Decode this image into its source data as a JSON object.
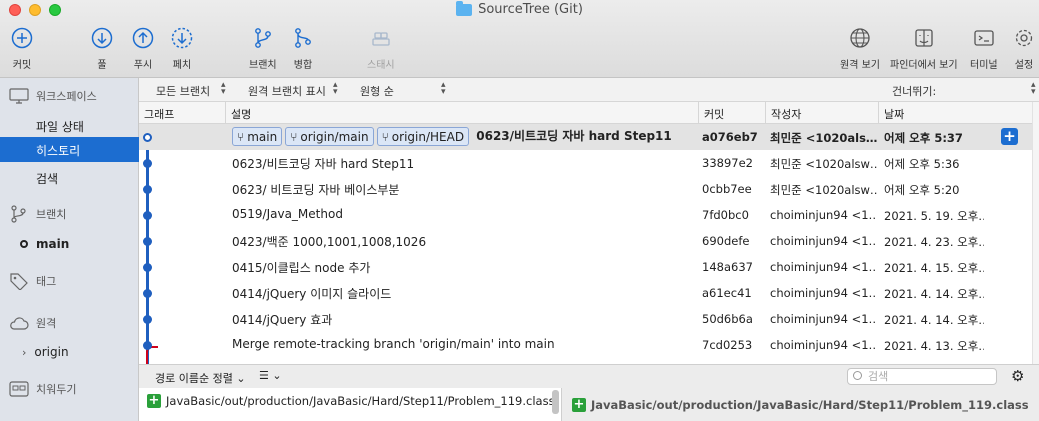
{
  "window": {
    "title": "SourceTree (Git)"
  },
  "toolbar": {
    "commit": "커밋",
    "pull": "풀",
    "push": "푸시",
    "fetch": "페치",
    "branch": "브랜치",
    "merge": "병합",
    "stash": "스태시",
    "remote_view": "원격 보기",
    "finder_view": "파인더에서 보기",
    "terminal": "터미널",
    "settings": "설정"
  },
  "filters": {
    "all_branches": "모든 브랜치",
    "show_remote": "원격 브랜치 표시",
    "order": "원형 순",
    "skip": "건너뛰기:"
  },
  "sidebar": {
    "workspace": "워크스페이스",
    "file_status": "파일 상태",
    "history": "히스토리",
    "search": "검색",
    "branches": "브랜치",
    "branch_main": "main",
    "tags": "태그",
    "remotes": "원격",
    "remote_origin": "origin",
    "stashes": "치워두기"
  },
  "columns": {
    "graph": "그래프",
    "description": "설명",
    "commit": "커밋",
    "author": "작성자",
    "date": "날짜"
  },
  "commits": [
    {
      "tags": [
        "main",
        "origin/main",
        "origin/HEAD"
      ],
      "message": "0623/비트코딩 자바 hard Step11",
      "hash": "a076eb7",
      "author": "최민준 <1020als…",
      "date": "어제 오후 5:37"
    },
    {
      "message": "0623/비트코딩 자바 hard Step11",
      "hash": "33897e2",
      "author": "최민준 <1020alsw…",
      "date": "어제 오후 5:36"
    },
    {
      "message": "0623/ 비트코딩 자바 베이스부분",
      "hash": "0cbb7ee",
      "author": "최민준 <1020alsw…",
      "date": "어제 오후 5:20"
    },
    {
      "message": "0519/Java_Method",
      "hash": "7fd0bc0",
      "author": "choiminjun94 <1…",
      "date": "2021. 5. 19. 오후…"
    },
    {
      "message": "0423/백준 1000,1001,1008,1026",
      "hash": "690defe",
      "author": "choiminjun94 <1…",
      "date": "2021. 4. 23. 오후…"
    },
    {
      "message": "0415/이클립스 node 추가",
      "hash": "148a637",
      "author": "choiminjun94 <1…",
      "date": "2021. 4. 15. 오후…"
    },
    {
      "message": "0414/jQuery 이미지 슬라이드",
      "hash": "a61ec41",
      "author": "choiminjun94 <1…",
      "date": "2021. 4. 14. 오후…"
    },
    {
      "message": "0414/jQuery 효과",
      "hash": "50d6b6a",
      "author": "choiminjun94 <1…",
      "date": "2021. 4. 14. 오후…"
    },
    {
      "message": "Merge remote-tracking branch 'origin/main' into main",
      "hash": "7cd0253",
      "author": "choiminjun94 <1…",
      "date": "2021. 4. 13. 오후…"
    }
  ],
  "bottom": {
    "sort": "경로 이름순 정렬",
    "search_placeholder": "검색"
  },
  "files": {
    "left": "JavaBasic/out/production/JavaBasic/Hard/Step11/Problem_119.class",
    "right": "JavaBasic/out/production/JavaBasic/Hard/Step11/Problem_119.class"
  },
  "colors": {
    "accent": "#1c6dd0",
    "graph": "#1f5fbf",
    "added": "#2aa03a"
  }
}
